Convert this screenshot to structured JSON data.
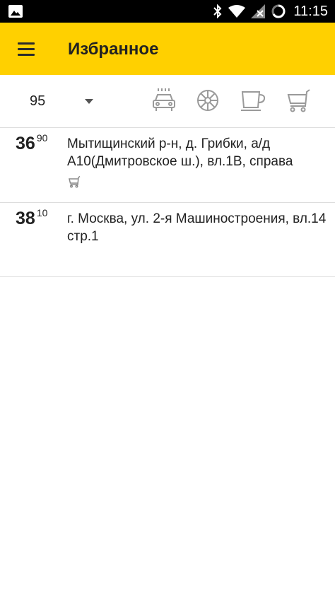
{
  "status_bar": {
    "time": "11:15",
    "icons": [
      "gallery-icon",
      "bluetooth-icon",
      "wifi-icon",
      "signal-icon",
      "battery-icon"
    ]
  },
  "app_bar": {
    "title": "Избранное",
    "menu_icon": "hamburger-menu-icon",
    "background_color": "#ffd000"
  },
  "filter_bar": {
    "fuel_type": "95",
    "filters": [
      "car-wash-icon",
      "tire-service-icon",
      "cafe-icon",
      "shop-cart-icon"
    ]
  },
  "stations": [
    {
      "price_main": "36",
      "price_cents": "90",
      "address": "Мытищинский р-н, д. Грибки, а/д А10(Дмитровское ш.), вл.1В, справа",
      "services": [
        "shop-cart-icon"
      ]
    },
    {
      "price_main": "38",
      "price_cents": "10",
      "address": "г. Москва, ул. 2-я Машиностроения, вл.14 стр.1",
      "services": []
    }
  ]
}
